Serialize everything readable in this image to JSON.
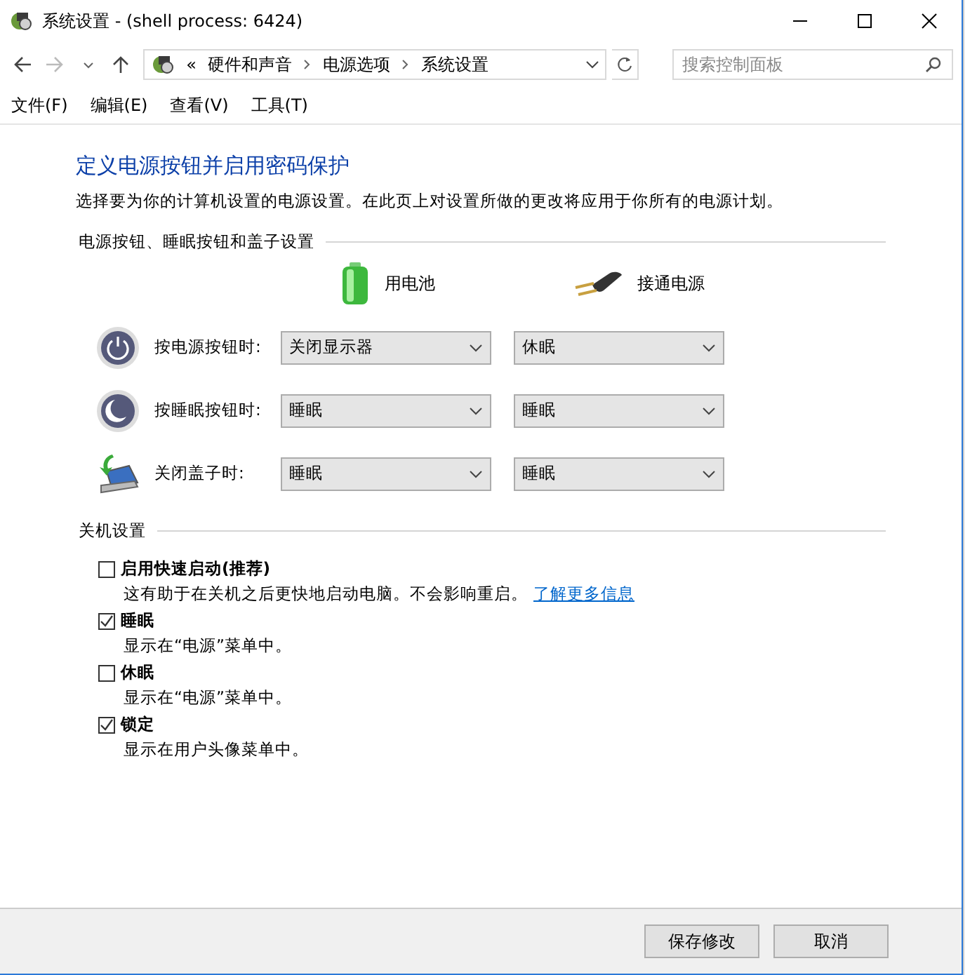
{
  "window": {
    "title": "系统设置 - (shell process: 6424)"
  },
  "address": {
    "overflow": "«",
    "crumbs": [
      "硬件和声音",
      "电源选项",
      "系统设置"
    ]
  },
  "search": {
    "placeholder": "搜索控制面板"
  },
  "menu": [
    "文件(F)",
    "编辑(E)",
    "查看(V)",
    "工具(T)"
  ],
  "heading": "定义电源按钮并启用密码保护",
  "intro": "选择要为你的计算机设置的电源设置。在此页上对设置所做的更改将应用于你所有的电源计划。",
  "power_section": {
    "title": "电源按钮、睡眠按钮和盖子设置",
    "columns": [
      "用电池",
      "接通电源"
    ],
    "rows": [
      {
        "kind": "power",
        "label": "按电源按钮时:",
        "values": [
          "关闭显示器",
          "休眠"
        ]
      },
      {
        "kind": "sleep",
        "label": "按睡眠按钮时:",
        "values": [
          "睡眠",
          "睡眠"
        ]
      },
      {
        "kind": "lid",
        "label": "关闭盖子时:",
        "values": [
          "睡眠",
          "睡眠"
        ]
      }
    ]
  },
  "shutdown_section": {
    "title": "关机设置",
    "options": [
      {
        "label": "启用快速启动(推荐)",
        "checked": false,
        "description": "这有助于在关机之后更快地启动电脑。不会影响重启。",
        "link": "了解更多信息"
      },
      {
        "label": "睡眠",
        "checked": true,
        "description": "显示在“电源”菜单中。"
      },
      {
        "label": "休眠",
        "checked": false,
        "description": "显示在“电源”菜单中。"
      },
      {
        "label": "锁定",
        "checked": true,
        "description": "显示在用户头像菜单中。"
      }
    ]
  },
  "buttons": [
    "保存修改",
    "取消"
  ]
}
